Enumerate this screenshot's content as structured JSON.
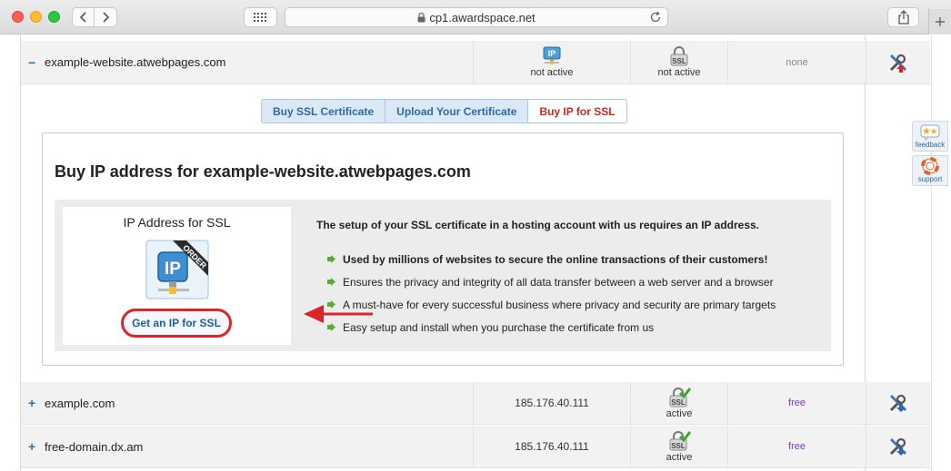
{
  "browser": {
    "url": "cp1.awardspace.net"
  },
  "rows": {
    "expanded": {
      "sign": "−",
      "domain": "example-website.atwebpages.com",
      "ip_status": "not active",
      "ssl_status": "not active",
      "cert": "none"
    },
    "row2": {
      "sign": "+",
      "domain": "example.com",
      "ip": "185.176.40.111",
      "ssl_status": "active",
      "cert": "free"
    },
    "row3": {
      "sign": "+",
      "domain": "free-domain.dx.am",
      "ip": "185.176.40.111",
      "ssl_status": "active",
      "cert": "free"
    }
  },
  "tabs": {
    "buy_ssl": "Buy SSL Certificate",
    "upload": "Upload Your Certificate",
    "buy_ip": "Buy IP for SSL"
  },
  "panel": {
    "title": "Buy IP address for example-website.atwebpages.com",
    "card_title": "IP Address for SSL",
    "card_image_text": "IP",
    "card_ribbon": "ORDER",
    "cta": "Get an IP for SSL",
    "intro": "The setup of your SSL certificate in a hosting account with us requires an IP address.",
    "bullets": [
      "Used by millions of websites to secure the online transactions of their customers!",
      "Ensures the privacy and integrity of all data transfer between a web server and a browser",
      "A must-have for every successful business where privacy and security are primary targets",
      "Easy setup and install when you purchase the certificate from us"
    ]
  },
  "icons": {
    "ip_badge": "IP",
    "ssl_badge": "SSL"
  },
  "side": {
    "feedback": "feedback",
    "support": "support"
  },
  "colors": {
    "accent_red": "#d8262b",
    "link_blue": "#2a6aa8",
    "free_purple": "#7b3fbf"
  }
}
